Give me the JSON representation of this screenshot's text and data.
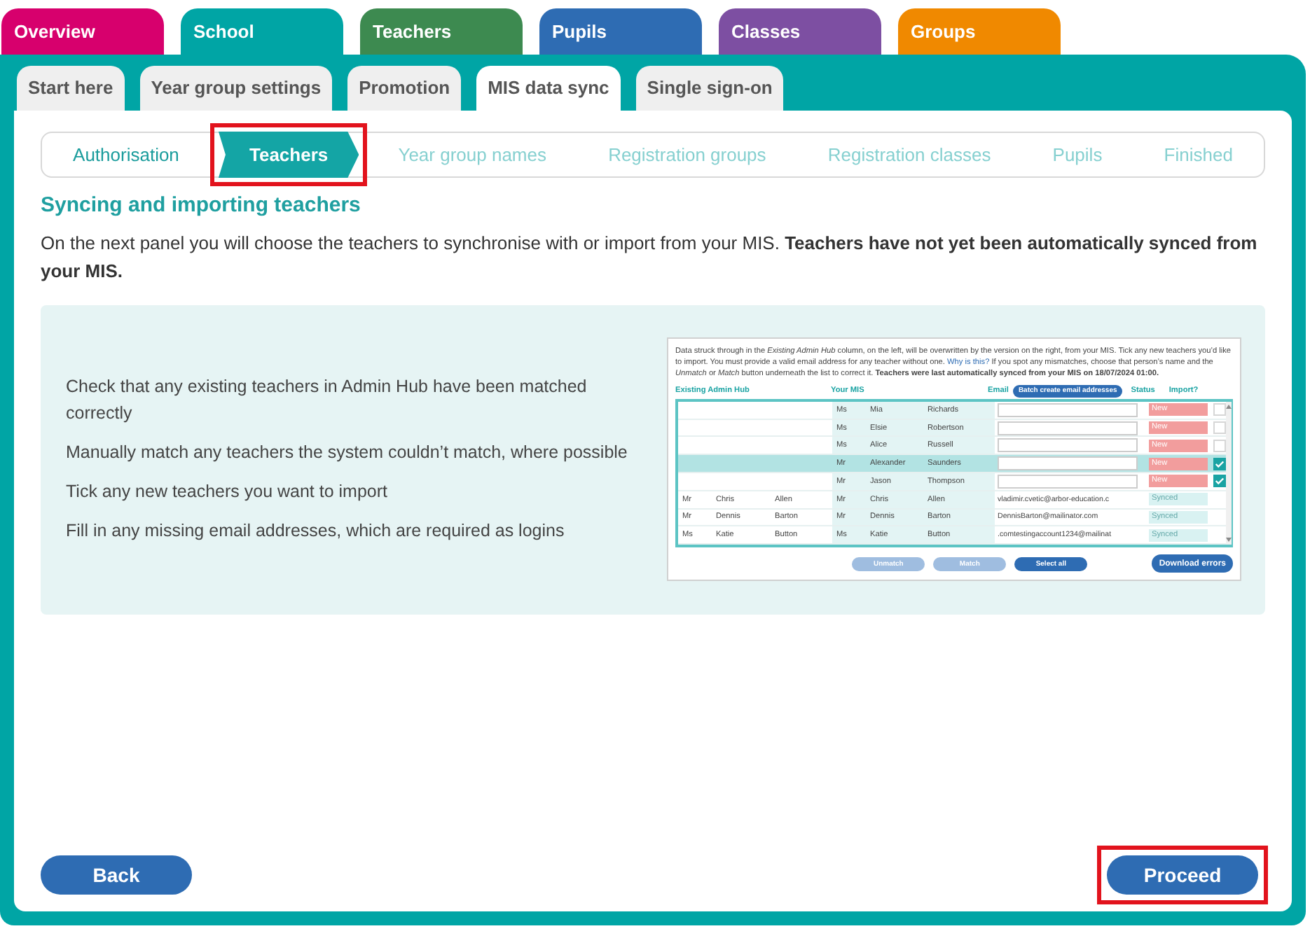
{
  "main_tabs": [
    {
      "label": "Overview",
      "color": "#d7006d",
      "selected": false
    },
    {
      "label": "School",
      "color": "#00a5a5",
      "selected": true
    },
    {
      "label": "Teachers",
      "color": "#3d8a50",
      "selected": false
    },
    {
      "label": "Pupils",
      "color": "#2e6cb3",
      "selected": false
    },
    {
      "label": "Classes",
      "color": "#7d4fa2",
      "selected": false
    },
    {
      "label": "Groups",
      "color": "#f08900",
      "selected": false
    }
  ],
  "sub_tabs": [
    {
      "label": "Start here",
      "selected": false
    },
    {
      "label": "Year group settings",
      "selected": false
    },
    {
      "label": "Promotion",
      "selected": false
    },
    {
      "label": "MIS data sync",
      "selected": true
    },
    {
      "label": "Single sign-on",
      "selected": false
    }
  ],
  "steps": [
    {
      "label": "Authorisation",
      "completed": true,
      "selected": false,
      "highlighted": false
    },
    {
      "label": "Teachers",
      "completed": false,
      "selected": true,
      "highlighted": true
    },
    {
      "label": "Year group names",
      "completed": false,
      "selected": false,
      "highlighted": false
    },
    {
      "label": "Registration groups",
      "completed": false,
      "selected": false,
      "highlighted": false
    },
    {
      "label": "Registration classes",
      "completed": false,
      "selected": false,
      "highlighted": false
    },
    {
      "label": "Pupils",
      "completed": false,
      "selected": false,
      "highlighted": false
    },
    {
      "label": "Finished",
      "completed": false,
      "selected": false,
      "highlighted": false
    }
  ],
  "heading": "Syncing and importing teachers",
  "intro": "On the next panel you will choose the teachers to synchronise with or import from your MIS. **Teachers have not yet been automatically synced from your MIS.**",
  "checklist": [
    "Check that any existing teachers in Admin Hub have been matched correctly",
    "Manually match any teachers the system couldn’t match, where possible",
    "Tick any new teachers you want to import",
    "Fill in any missing email addresses, which are required as logins"
  ],
  "preview": {
    "text_before": "Data struck through in the *Existing Admin Hub* column, on the left, will be overwritten by the version on the right, from your MIS. Tick any new teachers you’d like to import. You must provide a valid email address for any teacher without one.",
    "link": "Why is this?",
    "text_after": "If you spot any mismatches, choose that person’s name and the *Unmatch* or *Match* button underneath the list to correct it. **Teachers were last automatically synced from your MIS on 18/07/2024 01:00.**",
    "columns": {
      "existing": "Existing Admin Hub",
      "mis": "Your MIS",
      "email": "Email",
      "status": "Status",
      "import": "Import?"
    },
    "batch_button": "Batch create email addresses",
    "rows": [
      {
        "existing": [],
        "mis": [
          "Ms",
          "Mia",
          "Richards"
        ],
        "email": "",
        "status": {
          "label": "New",
          "kind": "new"
        },
        "import": false,
        "selected": false
      },
      {
        "existing": [],
        "mis": [
          "Ms",
          "Elsie",
          "Robertson"
        ],
        "email": "",
        "status": {
          "label": "New",
          "kind": "new"
        },
        "import": false,
        "selected": false
      },
      {
        "existing": [],
        "mis": [
          "Ms",
          "Alice",
          "Russell"
        ],
        "email": "",
        "status": {
          "label": "New",
          "kind": "new"
        },
        "import": false,
        "selected": false
      },
      {
        "existing": [],
        "mis": [
          "Mr",
          "Alexander",
          "Saunders"
        ],
        "email": "",
        "status": {
          "label": "New",
          "kind": "new"
        },
        "import": true,
        "selected": true
      },
      {
        "existing": [],
        "mis": [
          "Mr",
          "Jason",
          "Thompson"
        ],
        "email": "",
        "status": {
          "label": "New",
          "kind": "new"
        },
        "import": true,
        "selected": false
      },
      {
        "existing": [
          "Mr",
          "Chris",
          "Allen"
        ],
        "mis": [
          "Mr",
          "Chris",
          "Allen"
        ],
        "email": "vladimir.cvetic@arbor-education.c",
        "status": {
          "label": "Synced",
          "kind": "synced"
        },
        "selected": false
      },
      {
        "existing": [
          "Mr",
          "Dennis",
          "Barton"
        ],
        "mis": [
          "Mr",
          "Dennis",
          "Barton"
        ],
        "email": "DennisBarton@mailinator.com",
        "status": {
          "label": "Synced",
          "kind": "synced"
        },
        "selected": false
      },
      {
        "existing": [
          "Ms",
          "Katie",
          "Button"
        ],
        "mis": [
          "Ms",
          "Katie",
          "Button"
        ],
        "email": ".comtestingaccount1234@mailinat",
        "status": {
          "label": "Synced",
          "kind": "synced"
        },
        "selected": false
      }
    ],
    "buttons": [
      {
        "label": "Unmatch",
        "disabled": true
      },
      {
        "label": "Match",
        "disabled": true
      },
      {
        "label": "Select all",
        "disabled": false
      }
    ],
    "download_button": "Download errors"
  },
  "back_button": {
    "label": "Back",
    "highlighted": false
  },
  "proceed_button": {
    "label": "Proceed",
    "highlighted": true
  }
}
